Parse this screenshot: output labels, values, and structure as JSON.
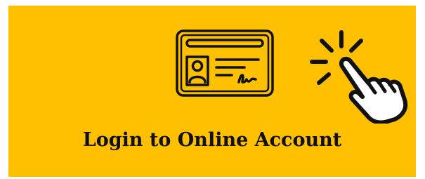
{
  "login_tile": {
    "label": "Login to Online Account",
    "background_color": "#ffc000",
    "icons": {
      "card": "id-card-icon",
      "pointer": "hand-click-icon"
    }
  }
}
